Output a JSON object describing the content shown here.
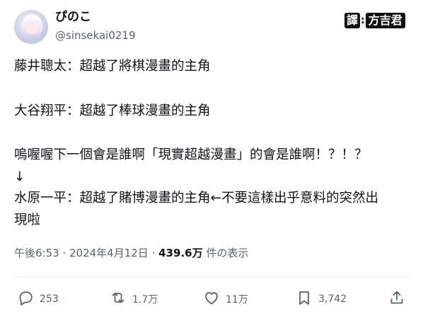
{
  "author": {
    "display_name": "ぴのこ",
    "handle": "@sinsekai0219"
  },
  "watermark": {
    "tag": "譯",
    "separator": ":",
    "name": "方吉君"
  },
  "tweet": {
    "lines": [
      "藤井聰太：超越了將棋漫畫的主角",
      "大谷翔平：超越了棒球漫畫的主角",
      "嗚喔喔下一個會是誰啊「現實超越漫畫」的會是誰啊！？！？",
      "↓",
      "水原一平：超越了賭博漫畫的主角←不要這樣出乎意料的突然出",
      "現啦"
    ]
  },
  "meta": {
    "time": "午後6:53",
    "sep1": " · ",
    "date": "2024年4月12日",
    "sep2": " · ",
    "views": "439.6万",
    "views_label": " 件の表示"
  },
  "actions": {
    "replies": "253",
    "retweets": "1.7万",
    "likes": "11万",
    "bookmarks": "3,742"
  }
}
